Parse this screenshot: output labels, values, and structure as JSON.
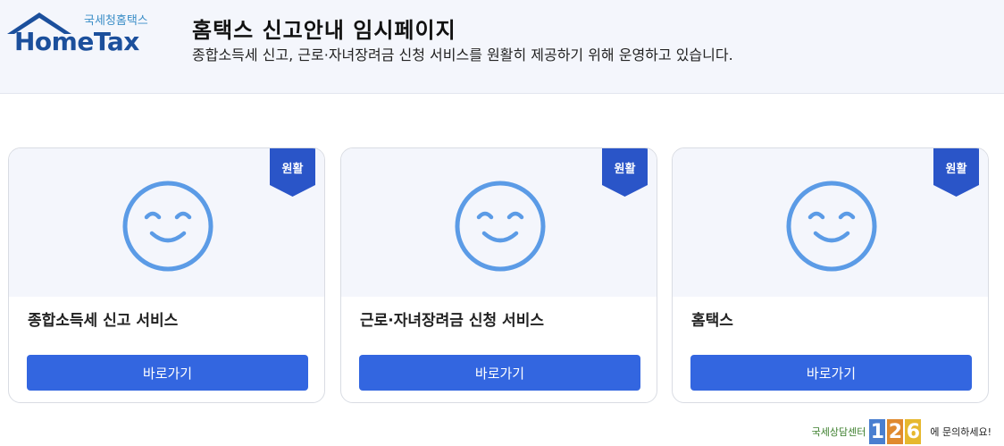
{
  "header": {
    "logo_sub": "국세청홈택스",
    "logo_main": "HomeTax",
    "title": "홈택스 신고안내 임시페이지",
    "description": "종합소득세 신고, 근로·자녀장려금 신청 서비스를 원활히 제공하기 위해 운영하고 있습니다."
  },
  "cards": [
    {
      "status": "원활",
      "title": "종합소득세 신고 서비스",
      "button": "바로가기"
    },
    {
      "status": "원활",
      "title": "근로·자녀장려금 신청 서비스",
      "button": "바로가기"
    },
    {
      "status": "원활",
      "title": "홈택스",
      "button": "바로가기"
    }
  ],
  "footer": {
    "label": "국세상담센터",
    "number": [
      "1",
      "2",
      "6"
    ],
    "tail": "에 문의하세요!"
  },
  "colors": {
    "primary_button": "#3366e0",
    "status_badge": "#2a55c8",
    "face": "#5b9be6",
    "logo_blue": "#1b4f9c"
  },
  "icons": [
    "hometax-logo",
    "smile-face-icon",
    "status-ribbon"
  ]
}
